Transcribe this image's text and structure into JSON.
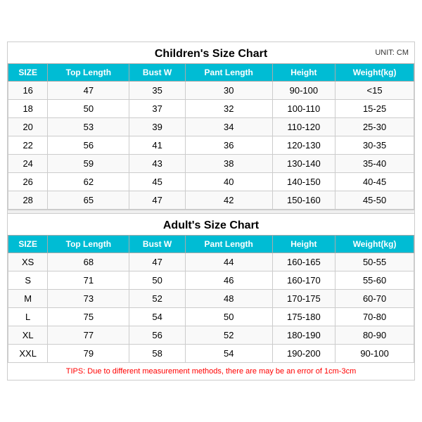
{
  "children_section": {
    "title": "Children's Size Chart",
    "unit": "UNIT: CM",
    "headers": [
      "SIZE",
      "Top Length",
      "Bust W",
      "Pant Length",
      "Height",
      "Weight(kg)"
    ],
    "rows": [
      [
        "16",
        "47",
        "35",
        "30",
        "90-100",
        "<15"
      ],
      [
        "18",
        "50",
        "37",
        "32",
        "100-110",
        "15-25"
      ],
      [
        "20",
        "53",
        "39",
        "34",
        "110-120",
        "25-30"
      ],
      [
        "22",
        "56",
        "41",
        "36",
        "120-130",
        "30-35"
      ],
      [
        "24",
        "59",
        "43",
        "38",
        "130-140",
        "35-40"
      ],
      [
        "26",
        "62",
        "45",
        "40",
        "140-150",
        "40-45"
      ],
      [
        "28",
        "65",
        "47",
        "42",
        "150-160",
        "45-50"
      ]
    ]
  },
  "adult_section": {
    "title": "Adult's Size Chart",
    "headers": [
      "SIZE",
      "Top Length",
      "Bust W",
      "Pant Length",
      "Height",
      "Weight(kg)"
    ],
    "rows": [
      [
        "XS",
        "68",
        "47",
        "44",
        "160-165",
        "50-55"
      ],
      [
        "S",
        "71",
        "50",
        "46",
        "160-170",
        "55-60"
      ],
      [
        "M",
        "73",
        "52",
        "48",
        "170-175",
        "60-70"
      ],
      [
        "L",
        "75",
        "54",
        "50",
        "175-180",
        "70-80"
      ],
      [
        "XL",
        "77",
        "56",
        "52",
        "180-190",
        "80-90"
      ],
      [
        "XXL",
        "79",
        "58",
        "54",
        "190-200",
        "90-100"
      ]
    ]
  },
  "tips": "TIPS: Due to different measurement methods, there are may be an error of 1cm-3cm"
}
